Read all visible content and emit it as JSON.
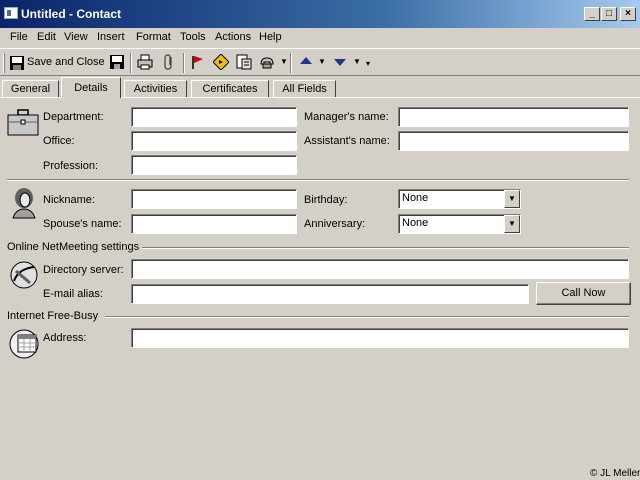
{
  "window": {
    "title": "Untitled - Contact",
    "min_glyph": "_",
    "max_glyph": "□",
    "close_glyph": "×"
  },
  "menu": [
    "File",
    "Edit",
    "View",
    "Insert",
    "Format",
    "Tools",
    "Actions",
    "Help"
  ],
  "toolbar": {
    "save_close_label": "Save and Close"
  },
  "tabs": [
    "General",
    "Details",
    "Activities",
    "Certificates",
    "All Fields"
  ],
  "active_tab": "Details",
  "form": {
    "department_label": "Department:",
    "office_label": "Office:",
    "profession_label": "Profession:",
    "managers_name_label": "Manager's name:",
    "assistants_name_label": "Assistant's name:",
    "nickname_label": "Nickname:",
    "spouses_name_label": "Spouse's name:",
    "birthday_label": "Birthday:",
    "birthday_value": "None",
    "anniversary_label": "Anniversary:",
    "anniversary_value": "None",
    "netmeeting_heading": "Online NetMeeting settings",
    "directory_server_label": "Directory server:",
    "email_alias_label": "E-mail alias:",
    "call_now_label": "Call Now",
    "freebusy_heading": "Internet Free-Busy",
    "address_label": "Address:"
  },
  "watermark": "© JL Meller",
  "colors": {
    "face": "#d4d0c8",
    "title_gradient_start": "#0a246a",
    "title_gradient_end": "#a6caf0"
  }
}
